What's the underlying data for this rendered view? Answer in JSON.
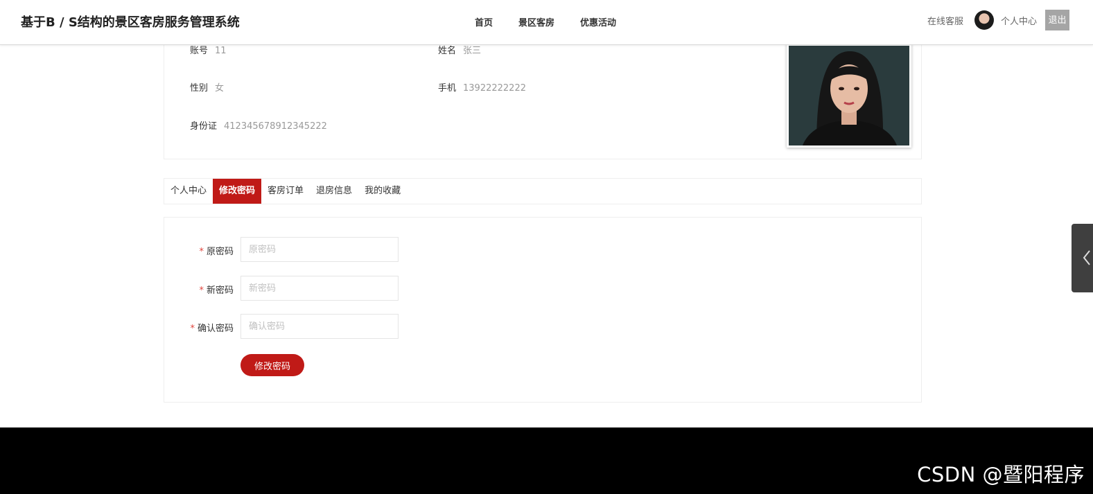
{
  "header": {
    "site_title": "基于B / S结构的景区客房服务管理系统",
    "nav": [
      "首页",
      "景区客房",
      "优惠活动"
    ],
    "online_service": "在线客服",
    "personal_center": "个人中心",
    "logout": "退出"
  },
  "profile": {
    "account_label": "账号",
    "account_value": "11",
    "name_label": "姓名",
    "name_value": "张三",
    "gender_label": "性别",
    "gender_value": "女",
    "phone_label": "手机",
    "phone_value": "13922222222",
    "id_label": "身份证",
    "id_value": "412345678912345222"
  },
  "tabs": [
    "个人中心",
    "修改密码",
    "客房订单",
    "退房信息",
    "我的收藏"
  ],
  "active_tab": "修改密码",
  "form": {
    "required_mark": "*",
    "old_password_label": "原密码",
    "old_password_placeholder": "原密码",
    "new_password_label": "新密码",
    "new_password_placeholder": "新密码",
    "confirm_password_label": "确认密码",
    "confirm_password_placeholder": "确认密码",
    "submit_label": "修改密码"
  },
  "watermark": "CSDN @暨阳程序",
  "colors": {
    "accent": "#c01a17",
    "logout_bg": "#a5a5a5",
    "footer_bg": "#000000"
  }
}
